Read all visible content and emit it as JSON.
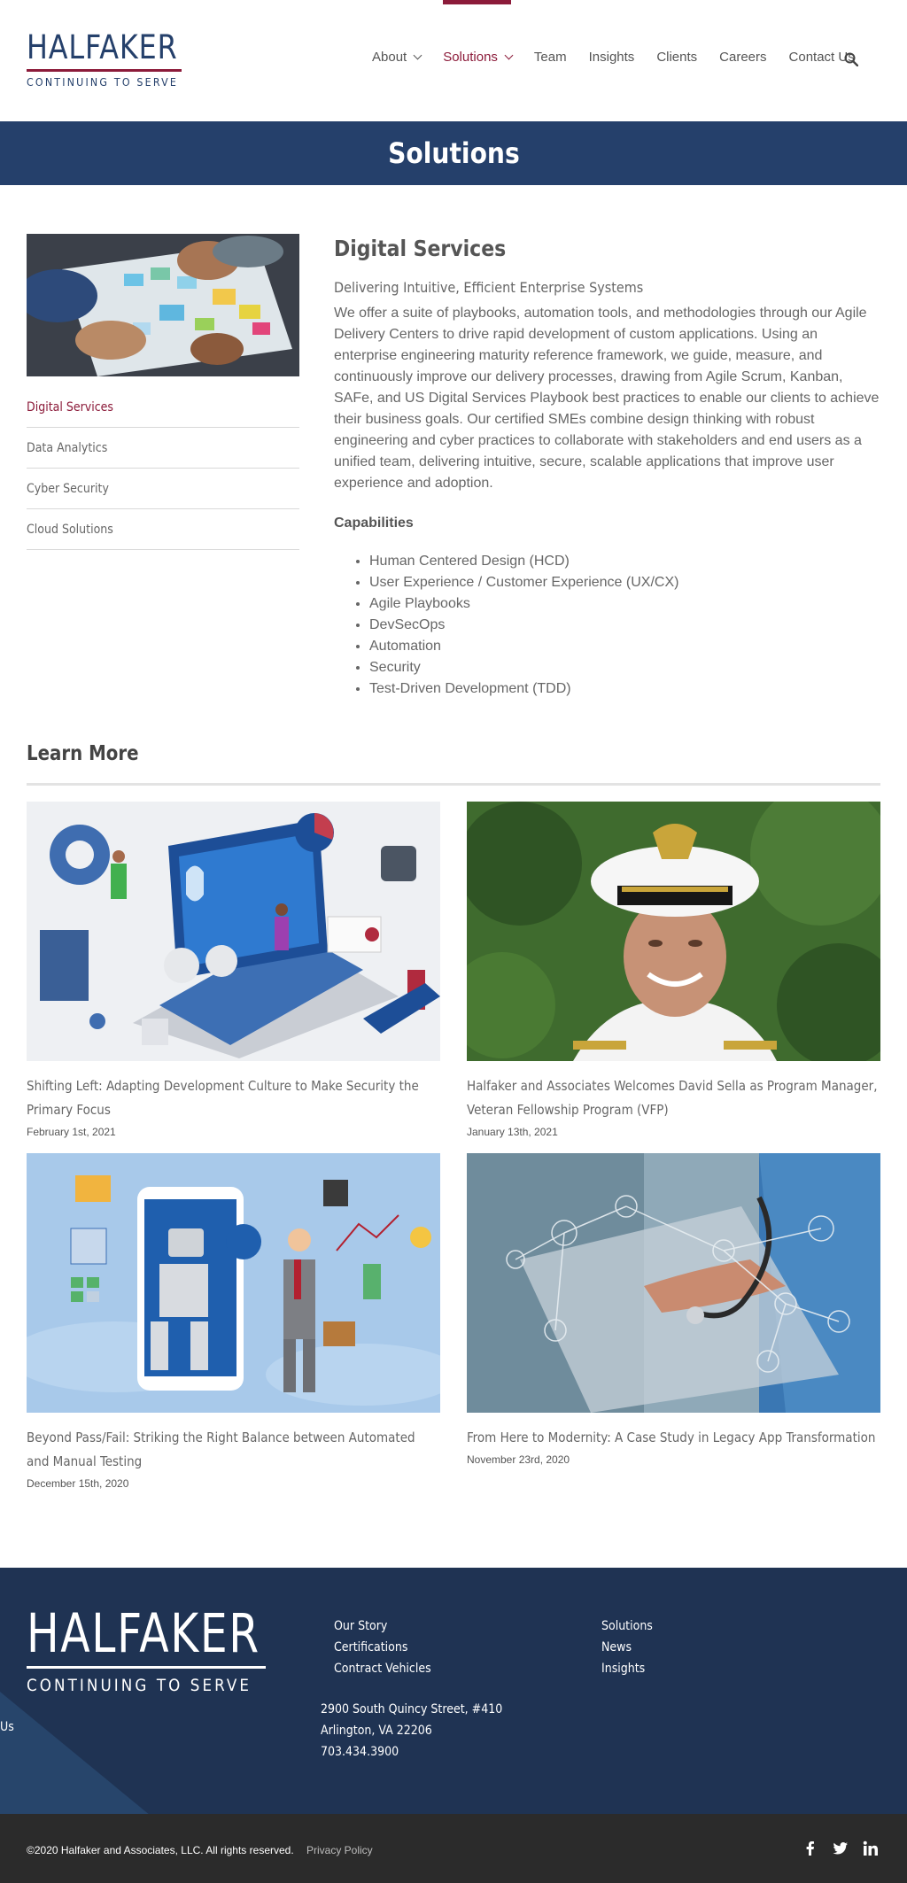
{
  "brand": {
    "name": "HALFAKER",
    "tagline": "CONTINUING TO SERVE",
    "primary_color": "#25406b",
    "accent_color": "#8c1b3a"
  },
  "nav": {
    "items": [
      {
        "label": "About",
        "has_dropdown": true
      },
      {
        "label": "Solutions",
        "has_dropdown": true,
        "active": true
      },
      {
        "label": "Team"
      },
      {
        "label": "Insights"
      },
      {
        "label": "Clients"
      },
      {
        "label": "Careers"
      },
      {
        "label": "Contact Us"
      }
    ],
    "search_icon": "search-icon"
  },
  "banner": {
    "title": "Solutions"
  },
  "sidebar": {
    "items": [
      {
        "label": "Digital Services",
        "active": true
      },
      {
        "label": "Data Analytics"
      },
      {
        "label": "Cyber Security"
      },
      {
        "label": "Cloud Solutions"
      }
    ]
  },
  "main": {
    "title": "Digital Services",
    "subtitle": "Delivering Intuitive, Efficient Enterprise Systems",
    "body": "We offer a suite of playbooks, automation tools, and methodologies through our Agile Delivery Centers to drive rapid development of custom applications. Using an enterprise engineering maturity reference framework, we guide, measure, and continuously improve our delivery processes, drawing from Agile Scrum, Kanban, SAFe, and US Digital Services Playbook best practices to enable our clients to achieve their business goals. Our certified SMEs combine design thinking with robust engineering and cyber practices to collaborate with stakeholders and end users as a unified team, delivering intuitive, secure, scalable applications that improve user experience and adoption.",
    "capabilities_title": "Capabilities",
    "capabilities": [
      "Human Centered Design (HCD)",
      "User Experience / Customer Experience (UX/CX)",
      "Agile Playbooks",
      "DevSecOps",
      "Automation",
      "Security",
      "Test-Driven Development (TDD)"
    ]
  },
  "learn_more": {
    "title": "Learn More",
    "posts": [
      {
        "title": "Shifting Left: Adapting Development Culture to Make Security the Primary Focus",
        "date": "February 1st, 2021"
      },
      {
        "title": "Halfaker and Associates Welcomes David Sella as Program Manager, Veteran Fellowship Program (VFP)",
        "date": "January 13th, 2021"
      },
      {
        "title": "Beyond Pass/Fail: Striking the Right Balance between Automated and Manual Testing",
        "date": "December 15th, 2020"
      },
      {
        "title": "From Here to Modernity: A Case Study in Legacy App Transformation",
        "date": "November 23rd, 2020"
      }
    ]
  },
  "footer": {
    "col1": [
      "Our Story",
      "Certifications",
      "Contract Vehicles"
    ],
    "col2": [
      "Solutions",
      "News",
      "Insights"
    ],
    "address": [
      "2900 South Quincy Street, #410",
      "Arlington, VA 22206",
      "703.434.3900"
    ],
    "partial_text": "Us",
    "copyright": "©2020 Halfaker and Associates, LLC. All rights reserved.",
    "privacy": "Privacy Policy",
    "social": [
      "facebook-icon",
      "twitter-icon",
      "linkedin-icon"
    ]
  }
}
